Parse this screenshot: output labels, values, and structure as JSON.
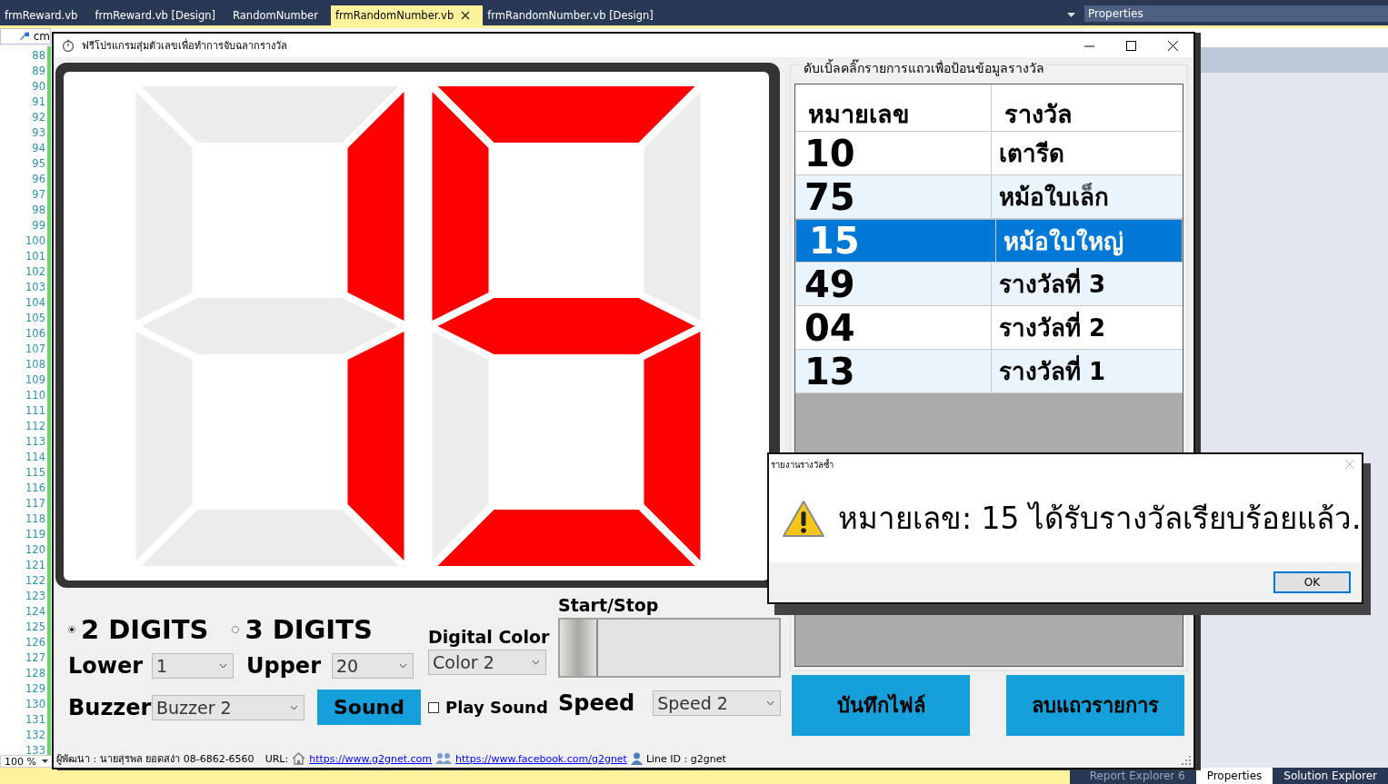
{
  "ide": {
    "tabs": [
      {
        "label": "frmReward.vb",
        "selected": false,
        "closable": false
      },
      {
        "label": "frmReward.vb [Design]",
        "selected": false,
        "closable": false
      },
      {
        "label": "RandomNumber",
        "selected": false,
        "closable": false
      },
      {
        "label": "frmRandomNumber.vb",
        "selected": true,
        "closable": true
      },
      {
        "label": "frmRandomNumber.vb [Design]",
        "selected": false,
        "closable": false
      }
    ],
    "code_selector": "cm",
    "line_numbers": [
      "88",
      "89",
      "90",
      "91",
      "92",
      "93",
      "94",
      "95",
      "96",
      "97",
      "98",
      "99",
      "100",
      "101",
      "102",
      "103",
      "104",
      "105",
      "106",
      "107",
      "108",
      "109",
      "110",
      "111",
      "112",
      "113",
      "114",
      "115",
      "116",
      "117",
      "118",
      "119",
      "120",
      "121",
      "122",
      "123",
      "124",
      "125",
      "126",
      "127",
      "128",
      "129",
      "130",
      "131",
      "132",
      "133"
    ],
    "zoom": "100 %",
    "properties_title": "Properties",
    "bottom_tabs": [
      {
        "label": "Report Explorer 6",
        "selected": false,
        "disabled": true
      },
      {
        "label": "Properties",
        "selected": true,
        "disabled": false
      },
      {
        "label": "Solution Explorer",
        "selected": false,
        "disabled": false
      }
    ]
  },
  "window": {
    "title": "ฟรีโปรแกรมสุ่มตัวเลขเพื่อทำการจับฉลากรางวัล",
    "display": {
      "digits": [
        {
          "segments": {
            "a": false,
            "b": true,
            "c": true,
            "d": false,
            "e": false,
            "f": false,
            "g": false
          }
        },
        {
          "segments": {
            "a": true,
            "b": false,
            "c": true,
            "d": true,
            "e": false,
            "f": true,
            "g": true
          }
        }
      ]
    },
    "digit_modes": [
      {
        "label": "2 DIGITS",
        "selected": true
      },
      {
        "label": "3 DIGITS",
        "selected": false
      }
    ],
    "lower": {
      "label": "Lower",
      "value": "1"
    },
    "upper": {
      "label": "Upper",
      "value": "20"
    },
    "digital_color": {
      "label": "Digital Color",
      "value": "Color 2"
    },
    "buzzer": {
      "label": "Buzzer",
      "value": "Buzzer 2"
    },
    "sound_button": "Sound",
    "play_sound": {
      "label": "Play Sound",
      "checked": false
    },
    "start_stop": {
      "label": "Start/Stop",
      "on": false
    },
    "speed": {
      "label": "Speed",
      "value": "Speed 2"
    },
    "prize_group": {
      "title": "ดับเบิ้ลคลิ๊กรายการแถวเพื่อป้อนข้อมูลรางวัล",
      "columns": [
        "หมายเลข",
        "รางวัล"
      ],
      "rows": [
        {
          "number": "10",
          "prize": "เตารีด",
          "selected": false
        },
        {
          "number": "75",
          "prize": "หม้อใบเล็ก",
          "selected": false
        },
        {
          "number": "15",
          "prize": "หม้อใบใหญ่",
          "selected": true
        },
        {
          "number": "49",
          "prize": "รางวัลที่ 3",
          "selected": false
        },
        {
          "number": "04",
          "prize": "รางวัลที่ 2",
          "selected": false
        },
        {
          "number": "13",
          "prize": "รางวัลที่ 1",
          "selected": false
        }
      ]
    },
    "buttons": [
      "บันทึกไฟล์",
      "ลบแถวรายการ"
    ],
    "status_bar": {
      "developer": "ผู้พัฒนา : นายสุรพล ยอดสง่า 08-6862-6560",
      "url_label": "URL:",
      "website": "https://www.g2gnet.com",
      "facebook": "https://www.facebook.com/g2gnet",
      "line_id": "Line ID : g2gnet"
    }
  },
  "dialog": {
    "title": "รายงานรางวัลซ้ำ",
    "message": "หมายเลข: 15 ได้รับรางวัลเรียบร้อยแล้ว.",
    "button": "OK"
  }
}
